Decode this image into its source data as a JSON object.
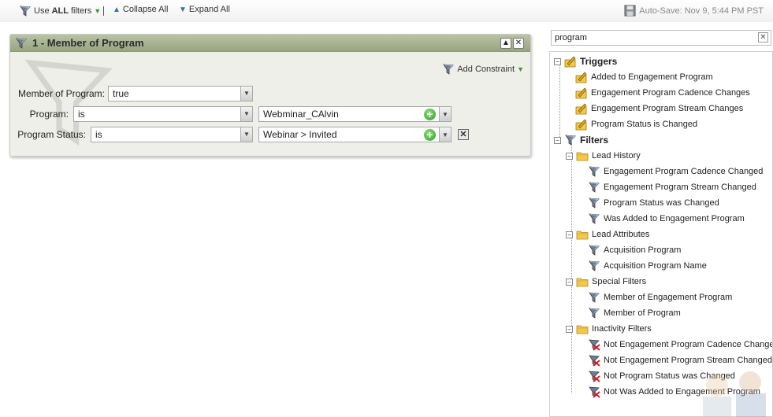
{
  "toolbar": {
    "use_prefix": "Use",
    "use_bold": "ALL",
    "use_suffix": "filters",
    "collapse_all": "Collapse All",
    "expand_all": "Expand All",
    "autosave": "Auto-Save: Nov 9, 5:44 PM PST"
  },
  "filter": {
    "title": "1 - Member of Program",
    "add_constraint": "Add Constraint",
    "rows": [
      {
        "label": "Member of Program:",
        "value": "true"
      },
      {
        "label": "Program:",
        "operator": "is",
        "value": "Webminar_CAlvin"
      },
      {
        "label": "Program Status:",
        "operator": "is",
        "value": "Webinar > Invited"
      }
    ]
  },
  "search": {
    "value": "program"
  },
  "tree": {
    "triggers_label": "Triggers",
    "triggers": [
      "Added to Engagement Program",
      "Engagement Program Cadence Changes",
      "Engagement Program Stream Changes",
      "Program Status is Changed"
    ],
    "filters_label": "Filters",
    "groups": [
      {
        "name": "Lead History",
        "items": [
          "Engagement Program Cadence Changed",
          "Engagement Program Stream Changed",
          "Program Status was Changed",
          "Was Added to Engagement Program"
        ]
      },
      {
        "name": "Lead Attributes",
        "items": [
          "Acquisition Program",
          "Acquisition Program Name"
        ]
      },
      {
        "name": "Special Filters",
        "items": [
          "Member of Engagement Program",
          "Member of Program"
        ]
      },
      {
        "name": "Inactivity Filters",
        "items": [
          "Not Engagement Program Cadence Changed",
          "Not Engagement Program Stream Changed",
          "Not Program Status was Changed",
          "Not Was Added to Engagement Program"
        ]
      }
    ]
  },
  "colors": {
    "header_green": "#98a57f",
    "add_green": "#2f9b22",
    "folder_yellow": "#f2c94c"
  }
}
